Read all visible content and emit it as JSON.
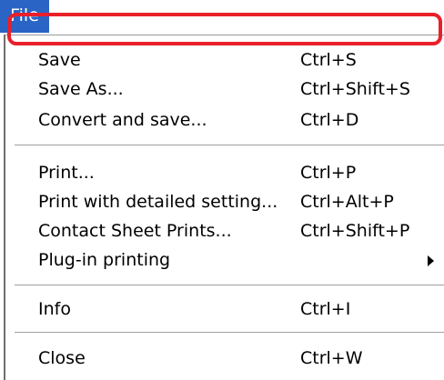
{
  "menubar": {
    "file_label": "File"
  },
  "menu": {
    "items": [
      {
        "label": "Save",
        "shortcut": "Ctrl+S"
      },
      {
        "label": "Save As...",
        "shortcut": "Ctrl+Shift+S"
      },
      {
        "label": "Convert and save...",
        "shortcut": "Ctrl+D"
      },
      {
        "label": "Print...",
        "shortcut": "Ctrl+P"
      },
      {
        "label": "Print with detailed setting...",
        "shortcut": "Ctrl+Alt+P"
      },
      {
        "label": "Contact Sheet Prints...",
        "shortcut": "Ctrl+Shift+P"
      },
      {
        "label": "Plug-in printing",
        "shortcut": ""
      },
      {
        "label": "Info",
        "shortcut": "Ctrl+I"
      },
      {
        "label": "Close",
        "shortcut": "Ctrl+W"
      }
    ]
  },
  "colors": {
    "menubar_active_bg": "#2a64c4",
    "highlight_outline": "#e8202a"
  },
  "icons": {
    "submenu_arrow": "chevron-right-icon"
  }
}
